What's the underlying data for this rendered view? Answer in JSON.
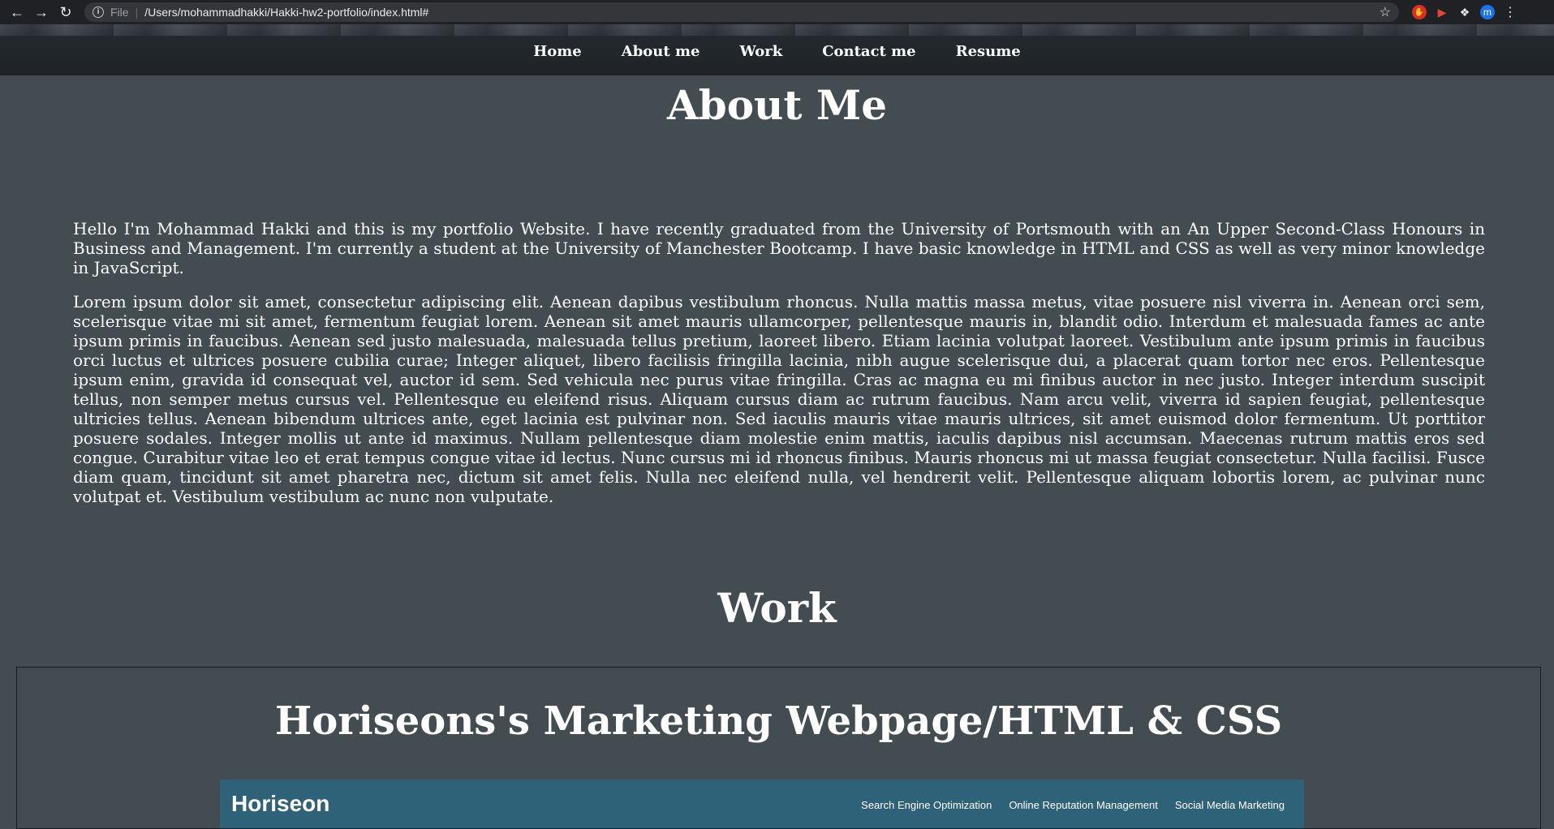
{
  "browser": {
    "file_label": "File",
    "url": "/Users/mohammadhakki/Hakki-hw2-portfolio/index.html#",
    "profile_initial": "m"
  },
  "nav": {
    "items": [
      "Home",
      "About me",
      "Work",
      "Contact me",
      "Resume"
    ]
  },
  "about": {
    "title": "About Me",
    "paragraph1": "Hello I'm Mohammad Hakki and this is my portfolio Website. I have recently graduated from the University of Portsmouth with an An Upper Second-Class Honours in Business and Management. I'm currently a student at the University of Manchester Bootcamp. I have basic knowledge in HTML and CSS as well as very minor knowledge in JavaScript.",
    "paragraph2": "Lorem ipsum dolor sit amet, consectetur adipiscing elit. Aenean dapibus vestibulum rhoncus. Nulla mattis massa metus, vitae posuere nisl viverra in. Aenean orci sem, scelerisque vitae mi sit amet, fermentum feugiat lorem. Aenean sit amet mauris ullamcorper, pellentesque mauris in, blandit odio. Interdum et malesuada fames ac ante ipsum primis in faucibus. Aenean sed justo malesuada, malesuada tellus pretium, laoreet libero. Etiam lacinia volutpat laoreet. Vestibulum ante ipsum primis in faucibus orci luctus et ultrices posuere cubilia curae; Integer aliquet, libero facilisis fringilla lacinia, nibh augue scelerisque dui, a placerat quam tortor nec eros. Pellentesque ipsum enim, gravida id consequat vel, auctor id sem. Sed vehicula nec purus vitae fringilla. Cras ac magna eu mi finibus auctor in nec justo. Integer interdum suscipit tellus, non semper metus cursus vel. Pellentesque eu eleifend risus. Aliquam cursus diam ac rutrum faucibus. Nam arcu velit, viverra id sapien feugiat, pellentesque ultricies tellus. Aenean bibendum ultrices ante, eget lacinia est pulvinar non. Sed iaculis mauris vitae mauris ultrices, sit amet euismod dolor fermentum. Ut porttitor posuere sodales. Integer mollis ut ante id maximus. Nullam pellentesque diam molestie enim mattis, iaculis dapibus nisl accumsan. Maecenas rutrum mattis eros sed congue. Curabitur vitae leo et erat tempus congue vitae id lectus. Nunc cursus mi id rhoncus finibus. Mauris rhoncus mi ut massa feugiat consectetur. Nulla facilisi. Fusce diam quam, tincidunt sit amet pharetra nec, dictum sit amet felis. Nulla nec eleifend nulla, vel hendrerit velit. Pellentesque aliquam lobortis lorem, ac pulvinar nunc volutpat et. Vestibulum vestibulum ac nunc non vulputate."
  },
  "work": {
    "title": "Work",
    "project": {
      "title": "Horiseons's Marketing Webpage/HTML & CSS",
      "screenshot_brand": "Horiseon",
      "screenshot_nav": [
        "Search Engine Optimization",
        "Online Reputation Management",
        "Social Media Marketing"
      ]
    }
  },
  "colors": {
    "page_bg": "#434c50",
    "header_bg": "#1f2326",
    "project_shot_bg": "#2d6279"
  }
}
